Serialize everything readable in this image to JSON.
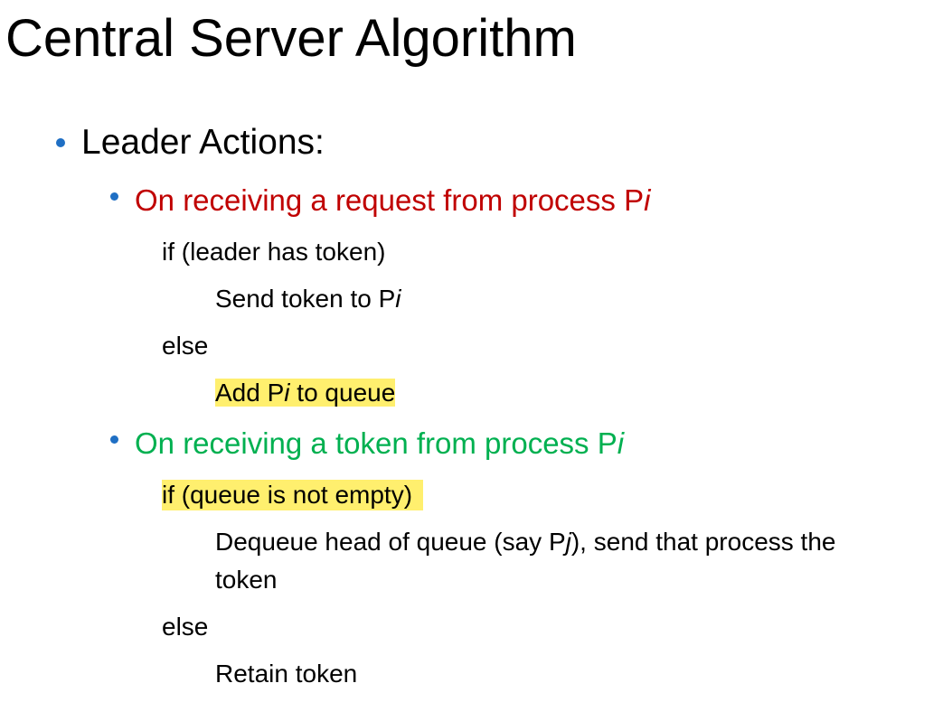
{
  "title": "Central Server Algorithm",
  "colors": {
    "bullet": "#1f6fc4",
    "request_heading": "#c00000",
    "token_heading": "#00b050",
    "highlight": "#ffef6e"
  },
  "leader": {
    "label": "Leader Actions:",
    "request": {
      "heading_prefix": "On receiving a request from process P",
      "heading_var": "i",
      "if_line": "if (leader has token)",
      "send_prefix": "Send token to P",
      "send_var": "i",
      "else_line": "else",
      "add_prefix": "Add P",
      "add_var": "i",
      "add_suffix": " to queue"
    },
    "token": {
      "heading_prefix": "On receiving a token from process P",
      "heading_var": "i",
      "if_line": "if (queue is not empty)",
      "dequeue_prefix": "Dequeue head of queue (say P",
      "dequeue_var": "j",
      "dequeue_suffix": "), send that process the",
      "dequeue_cont": "token",
      "else_line": "else",
      "retain_line": "Retain token"
    }
  }
}
